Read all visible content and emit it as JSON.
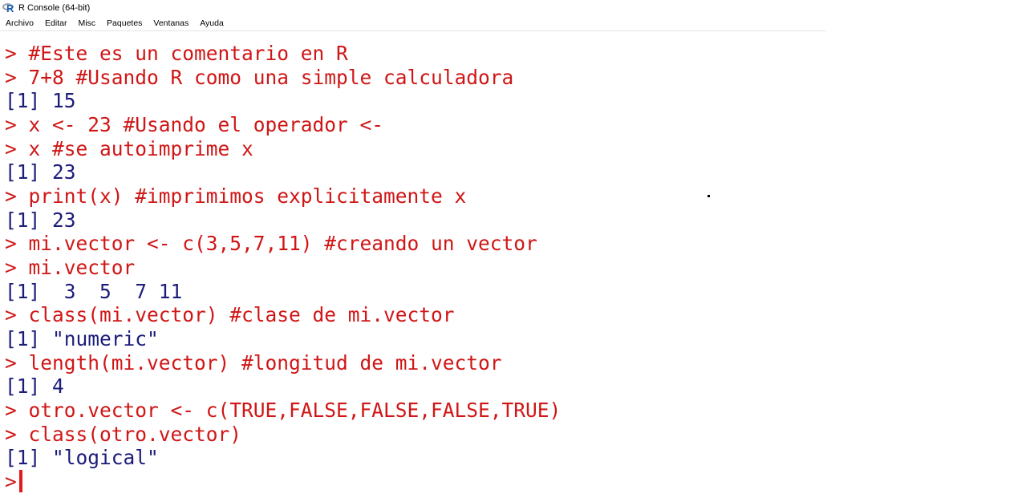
{
  "window": {
    "title": "R Console (64-bit)",
    "icon": "r-logo-icon"
  },
  "menu": {
    "items": [
      "Archivo",
      "Editar",
      "Misc",
      "Paquetes",
      "Ventanas",
      "Ayuda"
    ]
  },
  "console": {
    "prompt": ">",
    "lines": [
      {
        "type": "input",
        "text": "#Este es un comentario en R"
      },
      {
        "type": "input",
        "text": "7+8 #Usando R como una simple calculadora"
      },
      {
        "type": "output",
        "text": "[1] 15"
      },
      {
        "type": "input",
        "text": "x <- 23 #Usando el operador <-"
      },
      {
        "type": "input",
        "text": "x #se autoimprime x"
      },
      {
        "type": "output",
        "text": "[1] 23"
      },
      {
        "type": "input",
        "text": "print(x) #imprimimos explicitamente x"
      },
      {
        "type": "output",
        "text": "[1] 23"
      },
      {
        "type": "input",
        "text": "mi.vector <- c(3,5,7,11) #creando un vector"
      },
      {
        "type": "input",
        "text": "mi.vector"
      },
      {
        "type": "output",
        "text": "[1]  3  5  7 11"
      },
      {
        "type": "input",
        "text": "class(mi.vector) #clase de mi.vector"
      },
      {
        "type": "output",
        "text": "[1] \"numeric\""
      },
      {
        "type": "input",
        "text": "length(mi.vector) #longitud de mi.vector"
      },
      {
        "type": "output",
        "text": "[1] 4"
      },
      {
        "type": "input",
        "text": "otro.vector <- c(TRUE,FALSE,FALSE,FALSE,TRUE)"
      },
      {
        "type": "input",
        "text": "class(otro.vector)"
      },
      {
        "type": "output",
        "text": "[1] \"logical\""
      }
    ],
    "active_input": ""
  },
  "colors": {
    "input": "#d01616",
    "output": "#1c1c7a",
    "cursor": "#e21a1a",
    "background": "#ffffff"
  }
}
